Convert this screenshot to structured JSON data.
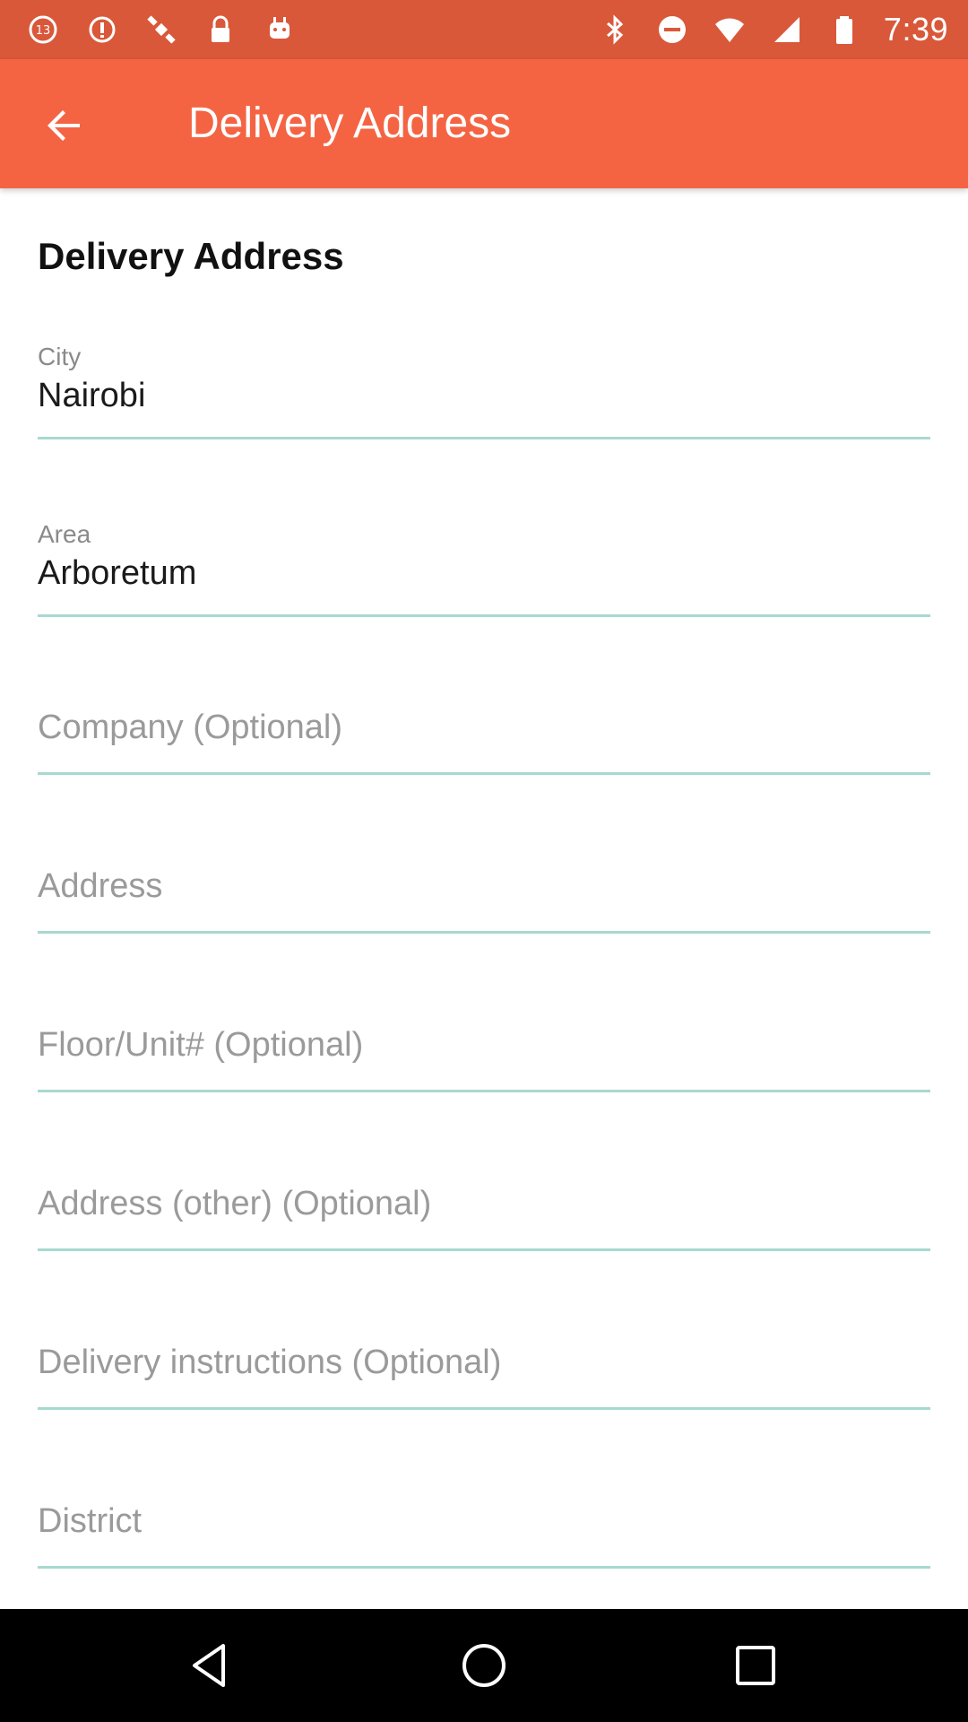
{
  "status_bar": {
    "time": "7:39",
    "left_icons": [
      "notification-13-icon",
      "fake-gps-icon",
      "satellite-icon",
      "lock-icon",
      "android-icon"
    ],
    "right_icons": [
      "bluetooth-icon",
      "do-not-disturb-icon",
      "wifi-icon",
      "signal-icon",
      "battery-icon"
    ]
  },
  "app_bar": {
    "title": "Delivery Address",
    "back_icon": "arrow-back-icon",
    "background": "#f46443"
  },
  "form": {
    "section_title": "Delivery Address",
    "city": {
      "label": "City",
      "value": "Nairobi"
    },
    "area": {
      "label": "Area",
      "value": "Arboretum"
    },
    "company": {
      "placeholder": "Company (Optional)"
    },
    "address": {
      "placeholder": "Address"
    },
    "floor_unit": {
      "placeholder": "Floor/Unit# (Optional)"
    },
    "address_other": {
      "placeholder": "Address (other) (Optional)"
    },
    "delivery_instructions": {
      "placeholder": "Delivery instructions (Optional)"
    },
    "district": {
      "placeholder": "District"
    },
    "underline_color": "#a8d9cf"
  },
  "nav_bar": {
    "back_icon": "nav-back-icon",
    "home_icon": "nav-home-icon",
    "recents_icon": "nav-recents-icon"
  }
}
